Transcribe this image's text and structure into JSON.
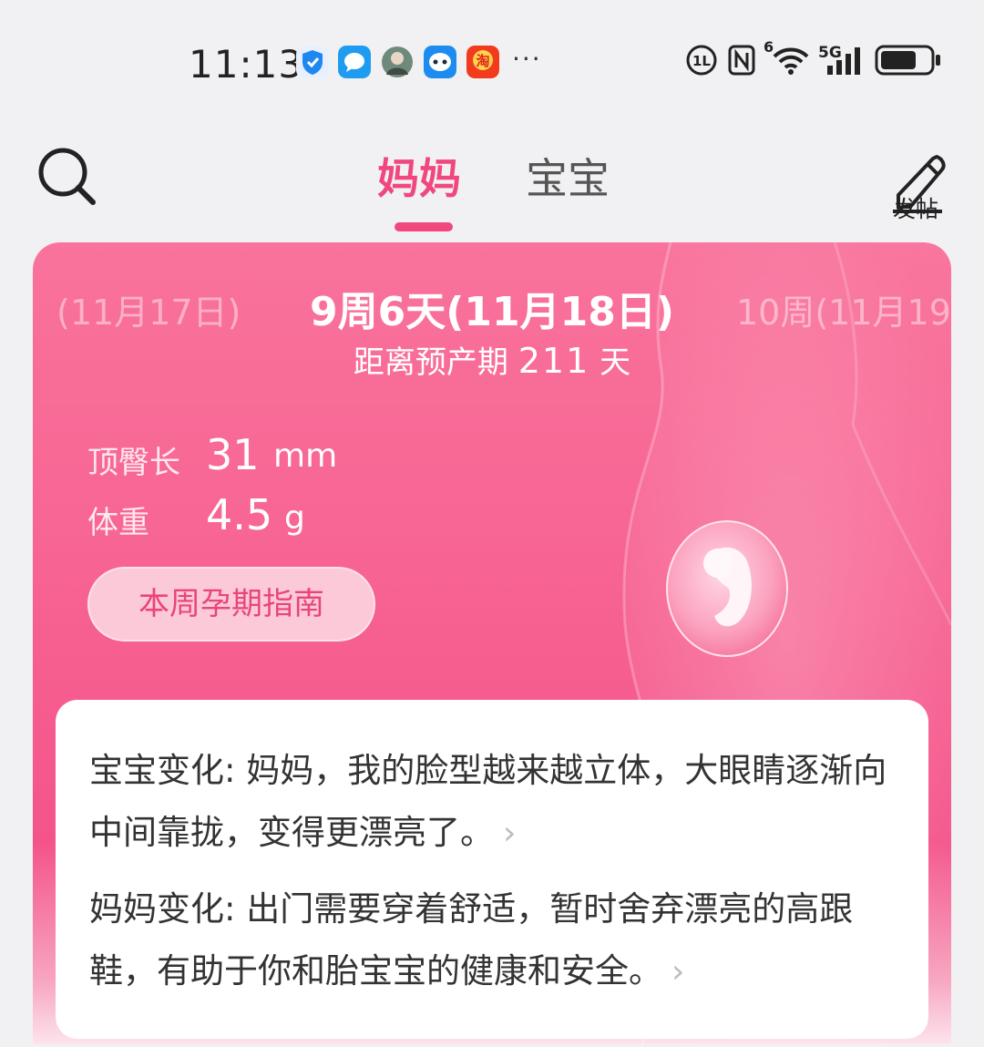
{
  "status_bar": {
    "time": "11:13",
    "more": "···",
    "network": "5G",
    "wifi_tag": "6"
  },
  "header": {
    "tabs": [
      {
        "label": "妈妈",
        "active": true
      },
      {
        "label": "宝宝",
        "active": false
      }
    ],
    "post_label": "发帖",
    "accent_color": "#f0487e"
  },
  "week_selector": {
    "prev": "(11月17日)",
    "current": "9周6天(11月18日)",
    "next": "10周(11月19"
  },
  "due": {
    "prefix": "距离预产期",
    "days": "211",
    "suffix": "天"
  },
  "stats": {
    "crl_label": "顶臀长",
    "crl_value": "31",
    "crl_unit": "mm",
    "weight_label": "体重",
    "weight_value": "4.5",
    "weight_unit": "g"
  },
  "guide_button": "本周孕期指南",
  "info": {
    "baby_title": "宝宝变化:",
    "baby_text": "妈妈，我的脸型越来越立体，大眼睛逐渐向中间靠拢，变得更漂亮了。",
    "mom_title": "妈妈变化:",
    "mom_text": "出门需要穿着舒适，暂时舍弃漂亮的高跟鞋，有助于你和胎宝宝的健康和安全。"
  }
}
